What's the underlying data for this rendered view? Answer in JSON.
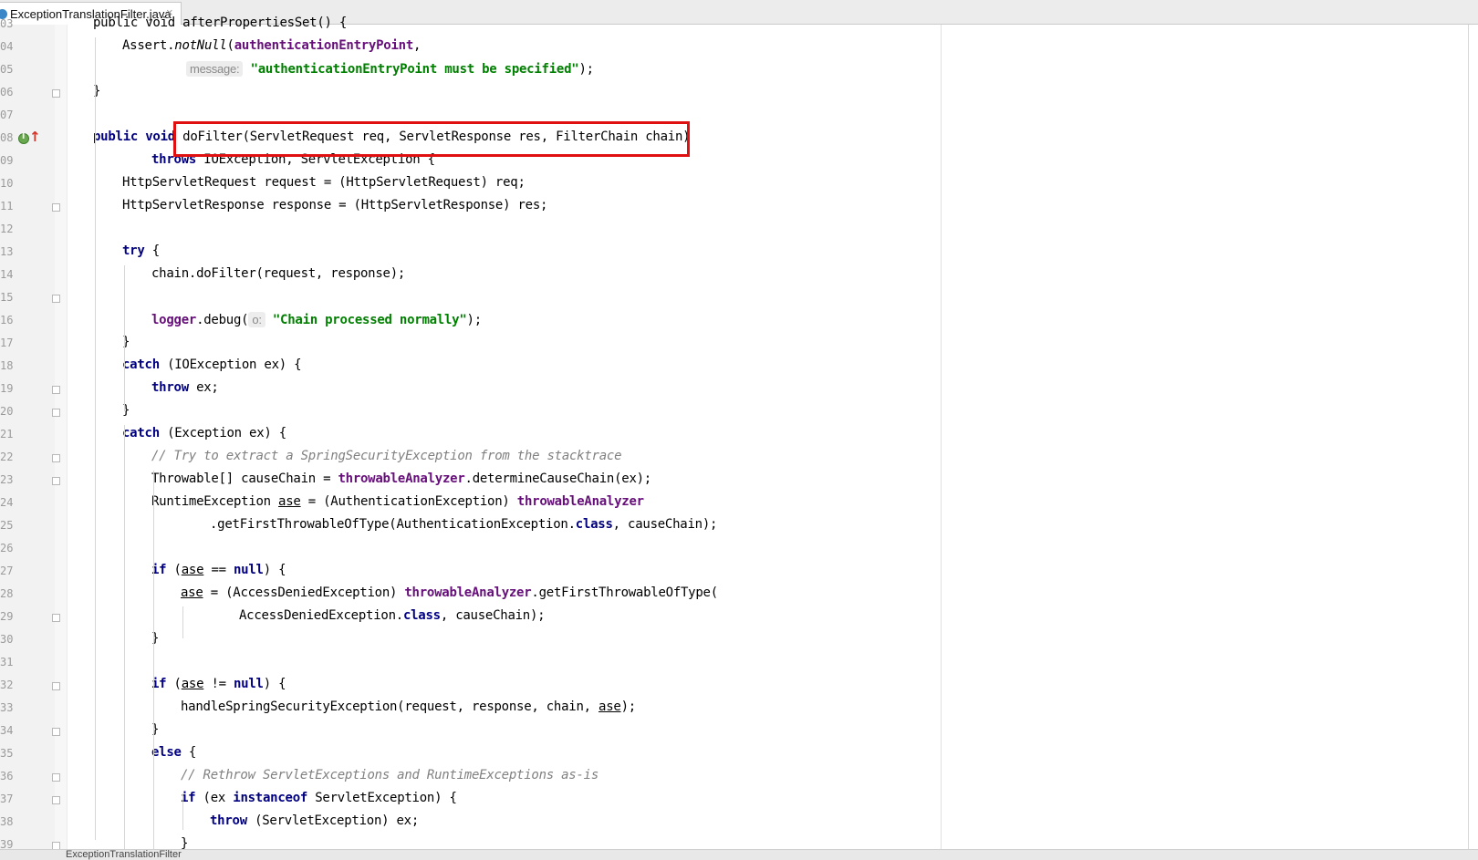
{
  "tab": {
    "file_name": "ExceptionTranslationFilter.java",
    "close_symbol": "×"
  },
  "status": {
    "text": "ExceptionTranslationFilter"
  },
  "lines": [
    {
      "num": "03",
      "tokens": [
        {
          "t": "public void afterPropertiesSet() {",
          "c": "p"
        }
      ]
    },
    {
      "num": "04",
      "tokens": [
        {
          "t": "Assert.",
          "c": "p"
        },
        {
          "t": "notNull",
          "c": "sm"
        },
        {
          "t": "(",
          "c": "p"
        },
        {
          "t": "authenticationEntryPoint",
          "c": "f"
        },
        {
          "t": ",",
          "c": "p"
        }
      ]
    },
    {
      "num": "05",
      "tokens": [
        {
          "t": "message:",
          "c": "h"
        },
        {
          "t": " ",
          "c": "p"
        },
        {
          "t": "\"authenticationEntryPoint must be specified\"",
          "c": "s"
        },
        {
          "t": ");",
          "c": "p"
        }
      ]
    },
    {
      "num": "06",
      "tokens": [
        {
          "t": "}",
          "c": "p"
        }
      ]
    },
    {
      "num": "07",
      "tokens": []
    },
    {
      "num": "08",
      "tokens": [
        {
          "t": "public void ",
          "c": "k"
        },
        {
          "t": "doFilter(ServletRequest req, ServletResponse res, FilterChain chain)",
          "c": "p"
        }
      ]
    },
    {
      "num": "09",
      "tokens": [
        {
          "t": "throws ",
          "c": "k"
        },
        {
          "t": "IOException, ServletException {",
          "c": "p"
        }
      ]
    },
    {
      "num": "10",
      "tokens": [
        {
          "t": "HttpServletRequest request = (HttpServletRequest) req;",
          "c": "p"
        }
      ]
    },
    {
      "num": "11",
      "tokens": [
        {
          "t": "HttpServletResponse response = (HttpServletResponse) res;",
          "c": "p"
        }
      ]
    },
    {
      "num": "12",
      "tokens": []
    },
    {
      "num": "13",
      "tokens": [
        {
          "t": "try ",
          "c": "k"
        },
        {
          "t": "{",
          "c": "p"
        }
      ]
    },
    {
      "num": "14",
      "tokens": [
        {
          "t": "chain.doFilter(request, response);",
          "c": "p"
        }
      ]
    },
    {
      "num": "15",
      "tokens": []
    },
    {
      "num": "16",
      "tokens": [
        {
          "t": "logger",
          "c": "f"
        },
        {
          "t": ".debug(",
          "c": "p"
        },
        {
          "t": "o:",
          "c": "h"
        },
        {
          "t": " ",
          "c": "p"
        },
        {
          "t": "\"Chain processed normally\"",
          "c": "s"
        },
        {
          "t": ");",
          "c": "p"
        }
      ]
    },
    {
      "num": "17",
      "tokens": [
        {
          "t": "}",
          "c": "p"
        }
      ]
    },
    {
      "num": "18",
      "tokens": [
        {
          "t": "catch ",
          "c": "k"
        },
        {
          "t": "(IOException ex) {",
          "c": "p"
        }
      ]
    },
    {
      "num": "19",
      "tokens": [
        {
          "t": "throw ",
          "c": "k"
        },
        {
          "t": "ex;",
          "c": "p"
        }
      ]
    },
    {
      "num": "20",
      "tokens": [
        {
          "t": "}",
          "c": "p"
        }
      ]
    },
    {
      "num": "21",
      "tokens": [
        {
          "t": "catch ",
          "c": "k"
        },
        {
          "t": "(Exception ex) {",
          "c": "p"
        }
      ]
    },
    {
      "num": "22",
      "tokens": [
        {
          "t": "// Try to extract a SpringSecurityException from the stacktrace",
          "c": "c"
        }
      ]
    },
    {
      "num": "23",
      "tokens": [
        {
          "t": "Throwable[] causeChain = ",
          "c": "p"
        },
        {
          "t": "throwableAnalyzer",
          "c": "f"
        },
        {
          "t": ".determineCauseChain(ex);",
          "c": "p"
        }
      ]
    },
    {
      "num": "24",
      "tokens": [
        {
          "t": "RuntimeException ",
          "c": "p"
        },
        {
          "t": "ase",
          "c": "u"
        },
        {
          "t": " = (AuthenticationException) ",
          "c": "p"
        },
        {
          "t": "throwableAnalyzer",
          "c": "f"
        }
      ]
    },
    {
      "num": "25",
      "tokens": [
        {
          "t": ".getFirstThrowableOfType(AuthenticationException.",
          "c": "p"
        },
        {
          "t": "class",
          "c": "k"
        },
        {
          "t": ", causeChain);",
          "c": "p"
        }
      ]
    },
    {
      "num": "26",
      "tokens": []
    },
    {
      "num": "27",
      "tokens": [
        {
          "t": "if ",
          "c": "k"
        },
        {
          "t": "(",
          "c": "p"
        },
        {
          "t": "ase",
          "c": "u"
        },
        {
          "t": " == ",
          "c": "p"
        },
        {
          "t": "null",
          "c": "k"
        },
        {
          "t": ") {",
          "c": "p"
        }
      ]
    },
    {
      "num": "28",
      "tokens": [
        {
          "t": "ase",
          "c": "u"
        },
        {
          "t": " = (AccessDeniedException) ",
          "c": "p"
        },
        {
          "t": "throwableAnalyzer",
          "c": "f"
        },
        {
          "t": ".getFirstThrowableOfType(",
          "c": "p"
        }
      ]
    },
    {
      "num": "29",
      "tokens": [
        {
          "t": "AccessDeniedException.",
          "c": "p"
        },
        {
          "t": "class",
          "c": "k"
        },
        {
          "t": ", causeChain);",
          "c": "p"
        }
      ]
    },
    {
      "num": "30",
      "tokens": [
        {
          "t": "}",
          "c": "p"
        }
      ]
    },
    {
      "num": "31",
      "tokens": []
    },
    {
      "num": "32",
      "tokens": [
        {
          "t": "if ",
          "c": "k"
        },
        {
          "t": "(",
          "c": "p"
        },
        {
          "t": "ase",
          "c": "u"
        },
        {
          "t": " != ",
          "c": "p"
        },
        {
          "t": "null",
          "c": "k"
        },
        {
          "t": ") {",
          "c": "p"
        }
      ]
    },
    {
      "num": "33",
      "tokens": [
        {
          "t": "handleSpringSecurityException(request, response, chain, ",
          "c": "p"
        },
        {
          "t": "ase",
          "c": "u"
        },
        {
          "t": ");",
          "c": "p"
        }
      ]
    },
    {
      "num": "34",
      "tokens": [
        {
          "t": "}",
          "c": "p"
        }
      ]
    },
    {
      "num": "35",
      "tokens": [
        {
          "t": "else ",
          "c": "k"
        },
        {
          "t": "{",
          "c": "p"
        }
      ]
    },
    {
      "num": "36",
      "tokens": [
        {
          "t": "// Rethrow ServletExceptions and RuntimeExceptions as-is",
          "c": "c"
        }
      ]
    },
    {
      "num": "37",
      "tokens": [
        {
          "t": "if ",
          "c": "k"
        },
        {
          "t": "(ex ",
          "c": "p"
        },
        {
          "t": "instanceof ",
          "c": "k"
        },
        {
          "t": "ServletException) {",
          "c": "p"
        }
      ]
    },
    {
      "num": "38",
      "tokens": [
        {
          "t": "throw ",
          "c": "k"
        },
        {
          "t": "(ServletException) ex;",
          "c": "p"
        }
      ]
    },
    {
      "num": "39",
      "tokens": [
        {
          "t": "}",
          "c": "p"
        }
      ]
    }
  ]
}
